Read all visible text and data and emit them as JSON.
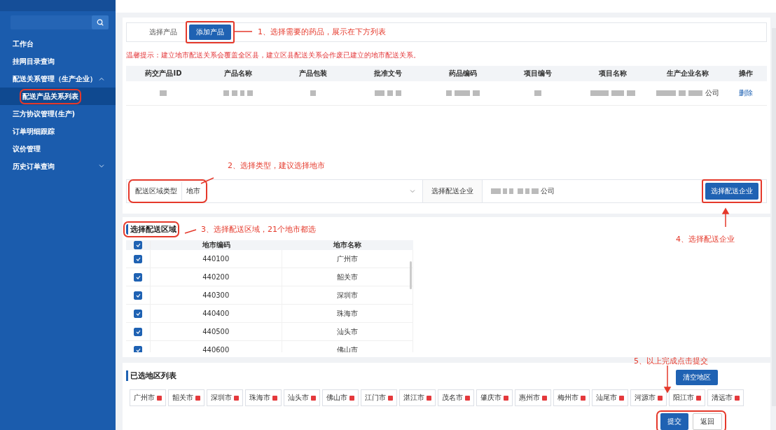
{
  "sidebar": {
    "items": [
      {
        "label": "工作台",
        "selected": false
      },
      {
        "label": "挂网目录查询",
        "selected": false
      },
      {
        "label": "配送关系管理（生产企业）",
        "selected": false,
        "expanded": true,
        "children": [
          {
            "label": "配送产品关系列表",
            "selected": true,
            "highlighted": true
          }
        ]
      },
      {
        "label": "三方协议管理(生产)",
        "selected": false
      },
      {
        "label": "订单明细跟踪",
        "selected": false
      },
      {
        "label": "议价管理",
        "selected": false
      },
      {
        "label": "历史订单查询",
        "selected": false,
        "expanded": false
      }
    ]
  },
  "product_picker": {
    "label": "选择产品",
    "button": {
      "label": "添加产品",
      "highlighted": true
    }
  },
  "notice": "温馨提示：建立地市配送关系会覆盖全区县，建立区县配送关系会作废已建立的地市配送关系。",
  "products": {
    "columns": [
      "药交产品ID",
      "产品名称",
      "产品包装",
      "批准文号",
      "药品编码",
      "项目编号",
      "项目名称",
      "生产企业名称",
      "操作"
    ],
    "rows": [
      {
        "cells": [
          {
            "kind": "redacted"
          },
          {
            "kind": "redacted"
          },
          {
            "kind": "redacted"
          },
          {
            "kind": "redacted"
          },
          {
            "kind": "redacted"
          },
          {
            "kind": "redacted"
          },
          {
            "kind": "redacted"
          },
          {
            "kind": "redacted",
            "text": "公司"
          },
          {
            "kind": "link",
            "text": "删除"
          }
        ]
      }
    ]
  },
  "region_bar": {
    "type_label": "配送区域类型",
    "type_value": "地市",
    "highlighted": true,
    "enterprise_label": "选择配送企业",
    "enterprise_value": "公司",
    "button": {
      "label": "选择配送企业",
      "highlighted": true
    }
  },
  "regions": {
    "title": "选择配送区域",
    "title_highlighted": true,
    "all_checked": true,
    "columns": [
      "地市编码",
      "地市名称"
    ],
    "rows": [
      {
        "code": "440100",
        "name": "广州市",
        "checked": true
      },
      {
        "code": "440200",
        "name": "韶关市",
        "checked": true
      },
      {
        "code": "440300",
        "name": "深圳市",
        "checked": true
      },
      {
        "code": "440400",
        "name": "珠海市",
        "checked": true
      },
      {
        "code": "440500",
        "name": "汕头市",
        "checked": true
      },
      {
        "code": "440600",
        "name": "佛山市",
        "checked": true
      }
    ]
  },
  "selected_regions": {
    "title": "已选地区列表",
    "clear_button": "清空地区",
    "tags": [
      "广州市",
      "韶关市",
      "深圳市",
      "珠海市",
      "汕头市",
      "佛山市",
      "江门市",
      "湛江市",
      "茂名市",
      "肇庆市",
      "惠州市",
      "梅州市",
      "汕尾市",
      "河源市",
      "阳江市",
      "清远市"
    ]
  },
  "actions": {
    "highlighted": true,
    "buttons": [
      {
        "label": "提交",
        "kind": "primary"
      },
      {
        "label": "返回",
        "kind": "default"
      }
    ]
  },
  "annotations": [
    {
      "text": "1、选择需要的药品，展示在下方列表"
    },
    {
      "text": "2、选择类型，建议选择地市"
    },
    {
      "text": "3、选择配送区域，21个地市都选"
    },
    {
      "text": "4、选择配送企业"
    },
    {
      "text": "5、以上完成点击提交"
    }
  ]
}
